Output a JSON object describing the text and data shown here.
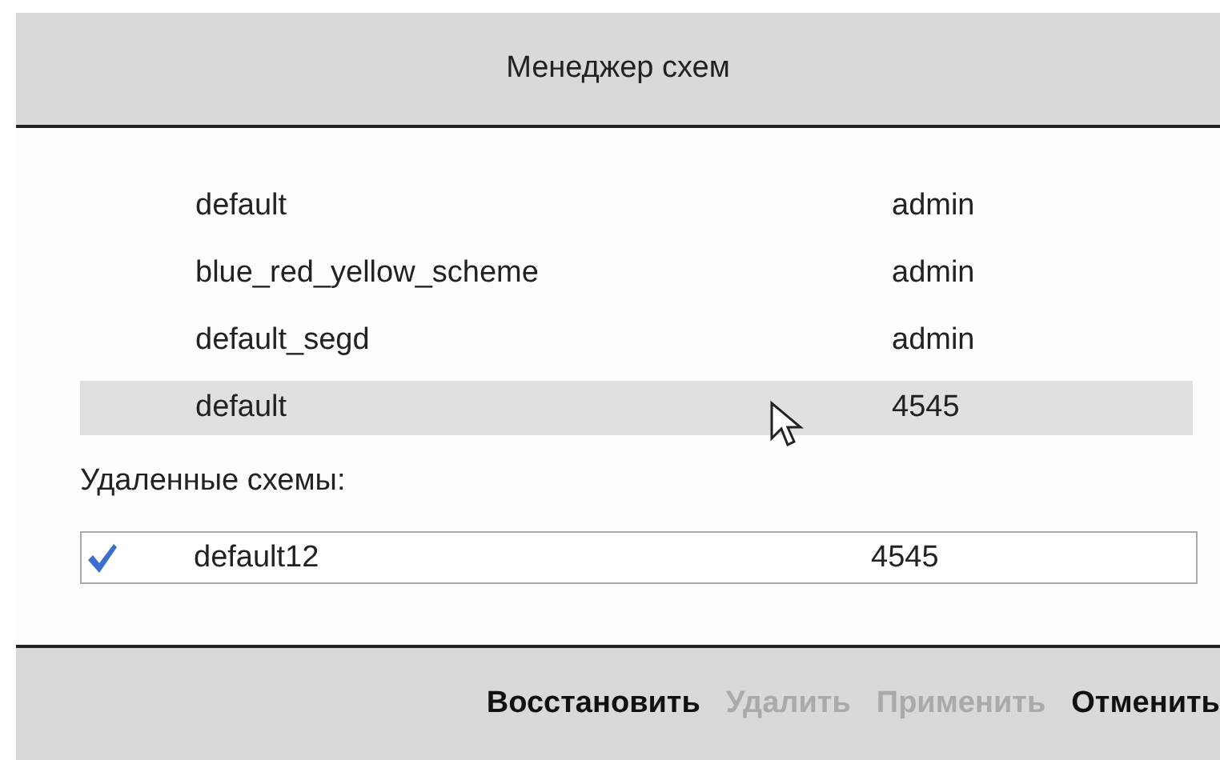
{
  "window": {
    "title": "Менеджер схем"
  },
  "schemes": [
    {
      "name": "default",
      "user": "admin",
      "selected": false
    },
    {
      "name": "blue_red_yellow_scheme",
      "user": "admin",
      "selected": false
    },
    {
      "name": "default_segd",
      "user": "admin",
      "selected": false
    },
    {
      "name": "default",
      "user": "4545",
      "selected": true
    }
  ],
  "deleted_label": "Удаленные схемы:",
  "deleted": [
    {
      "name": "default12",
      "user": "4545",
      "checked": true
    }
  ],
  "buttons": [
    {
      "label": "Восстановить",
      "disabled": false
    },
    {
      "label": "Удалить",
      "disabled": true
    },
    {
      "label": "Применить",
      "disabled": true
    },
    {
      "label": "Отменить",
      "disabled": false
    }
  ]
}
